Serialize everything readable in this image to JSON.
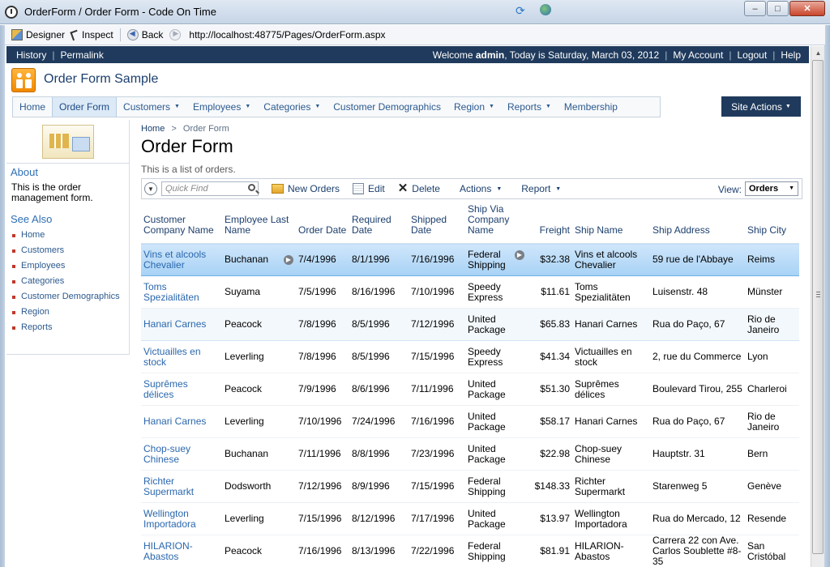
{
  "window": {
    "title": "OrderForm / Order Form - Code On Time",
    "minimize": "–",
    "maximize": "□",
    "close": "✕"
  },
  "toolbar": {
    "designer": "Designer",
    "inspect": "Inspect",
    "back": "Back",
    "url": "http://localhost:48775/Pages/OrderForm.aspx"
  },
  "topbar": {
    "history": "History",
    "permalink": "Permalink",
    "welcome_prefix": "Welcome ",
    "user": "admin",
    "welcome_suffix": ", Today is Saturday, March 03, 2012",
    "my_account": "My Account",
    "logout": "Logout",
    "help": "Help"
  },
  "site": {
    "title": "Order Form Sample"
  },
  "menu": [
    {
      "label": "Home",
      "caret": false,
      "active": false
    },
    {
      "label": "Order Form",
      "caret": false,
      "active": true
    },
    {
      "label": "Customers",
      "caret": true,
      "active": false
    },
    {
      "label": "Employees",
      "caret": true,
      "active": false
    },
    {
      "label": "Categories",
      "caret": true,
      "active": false
    },
    {
      "label": "Customer Demographics",
      "caret": false,
      "active": false
    },
    {
      "label": "Region",
      "caret": true,
      "active": false
    },
    {
      "label": "Reports",
      "caret": true,
      "active": false
    },
    {
      "label": "Membership",
      "caret": false,
      "active": false
    }
  ],
  "site_actions": "Site Actions",
  "sidebar": {
    "about_title": "About",
    "about_text": "This is the order management form.",
    "see_also_title": "See Also",
    "links": [
      "Home",
      "Customers",
      "Employees",
      "Categories",
      "Customer Demographics",
      "Region",
      "Reports"
    ]
  },
  "main": {
    "crumb_home": "Home",
    "crumb_sep": ">",
    "crumb_current": "Order Form",
    "title": "Order Form",
    "description": "This is a list of orders.",
    "quick_find_placeholder": "Quick Find",
    "new_orders": "New Orders",
    "edit": "Edit",
    "delete": "Delete",
    "actions": "Actions",
    "report": "Report",
    "view_label": "View:",
    "view_value": "Orders"
  },
  "grid": {
    "columns": [
      "Customer Company Name",
      "Employee Last Name",
      "Order Date",
      "Required Date",
      "Shipped Date",
      "Ship Via Company Name",
      "Freight",
      "Ship Name",
      "Ship Address",
      "Ship City"
    ],
    "rows": [
      [
        "Vins et alcools Chevalier",
        "Buchanan",
        "7/4/1996",
        "8/1/1996",
        "7/16/1996",
        "Federal Shipping",
        "$32.38",
        "Vins et alcools Chevalier",
        "59 rue de l'Abbaye",
        "Reims"
      ],
      [
        "Toms Spezialitäten",
        "Suyama",
        "7/5/1996",
        "8/16/1996",
        "7/10/1996",
        "Speedy Express",
        "$11.61",
        "Toms Spezialitäten",
        "Luisenstr. 48",
        "Münster"
      ],
      [
        "Hanari Carnes",
        "Peacock",
        "7/8/1996",
        "8/5/1996",
        "7/12/1996",
        "United Package",
        "$65.83",
        "Hanari Carnes",
        "Rua do Paço, 67",
        "Rio de Janeiro"
      ],
      [
        "Victuailles en stock",
        "Leverling",
        "7/8/1996",
        "8/5/1996",
        "7/15/1996",
        "Speedy Express",
        "$41.34",
        "Victuailles en stock",
        "2, rue du Commerce",
        "Lyon"
      ],
      [
        "Suprêmes délices",
        "Peacock",
        "7/9/1996",
        "8/6/1996",
        "7/11/1996",
        "United Package",
        "$51.30",
        "Suprêmes délices",
        "Boulevard Tirou, 255",
        "Charleroi"
      ],
      [
        "Hanari Carnes",
        "Leverling",
        "7/10/1996",
        "7/24/1996",
        "7/16/1996",
        "United Package",
        "$58.17",
        "Hanari Carnes",
        "Rua do Paço, 67",
        "Rio de Janeiro"
      ],
      [
        "Chop-suey Chinese",
        "Buchanan",
        "7/11/1996",
        "8/8/1996",
        "7/23/1996",
        "United Package",
        "$22.98",
        "Chop-suey Chinese",
        "Hauptstr. 31",
        "Bern"
      ],
      [
        "Richter Supermarkt",
        "Dodsworth",
        "7/12/1996",
        "8/9/1996",
        "7/15/1996",
        "Federal Shipping",
        "$148.33",
        "Richter Supermarkt",
        "Starenweg 5",
        "Genève"
      ],
      [
        "Wellington Importadora",
        "Leverling",
        "7/15/1996",
        "8/12/1996",
        "7/17/1996",
        "United Package",
        "$13.97",
        "Wellington Importadora",
        "Rua do Mercado, 12",
        "Resende"
      ],
      [
        "HILARION-Abastos",
        "Peacock",
        "7/16/1996",
        "8/13/1996",
        "7/22/1996",
        "Federal Shipping",
        "$81.91",
        "HILARION-Abastos",
        "Carrera 22 con Ave. Carlos Soublette #8-35",
        "San Cristóbal"
      ]
    ]
  }
}
